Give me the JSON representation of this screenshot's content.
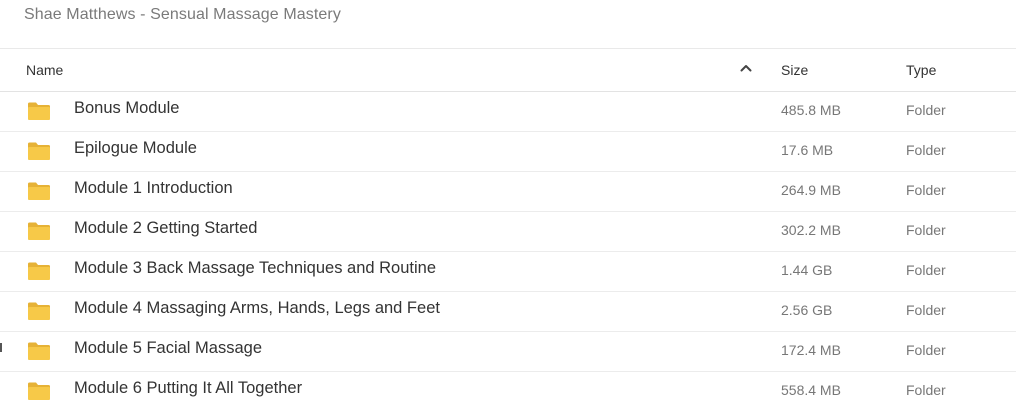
{
  "breadcrumb": {
    "title": "Shae Matthews - Sensual Massage Mastery"
  },
  "columns": {
    "name": "Name",
    "size": "Size",
    "type": "Type",
    "sort_icon": "chevron-up-icon"
  },
  "colors": {
    "folder": "#F7C948",
    "folder_dark": "#E6B236",
    "text": "#333333",
    "muted": "#777777",
    "divider": "#ECECEC"
  },
  "rows": [
    {
      "name": "Bonus Module",
      "size": "485.8 MB",
      "type": "Folder",
      "icon": "folder-icon"
    },
    {
      "name": "Epilogue Module",
      "size": "17.6 MB",
      "type": "Folder",
      "icon": "folder-icon"
    },
    {
      "name": "Module 1 Introduction",
      "size": "264.9 MB",
      "type": "Folder",
      "icon": "folder-icon"
    },
    {
      "name": "Module 2 Getting Started",
      "size": "302.2 MB",
      "type": "Folder",
      "icon": "folder-icon"
    },
    {
      "name": "Module 3 Back Massage Techniques and Routine",
      "size": "1.44 GB",
      "type": "Folder",
      "icon": "folder-icon"
    },
    {
      "name": "Module 4 Massaging Arms, Hands, Legs and Feet",
      "size": "2.56 GB",
      "type": "Folder",
      "icon": "folder-icon"
    },
    {
      "name": "Module 5 Facial Massage",
      "size": "172.4 MB",
      "type": "Folder",
      "icon": "folder-icon"
    },
    {
      "name": "Module 6 Putting It All Together",
      "size": "558.4 MB",
      "type": "Folder",
      "icon": "folder-icon"
    }
  ]
}
